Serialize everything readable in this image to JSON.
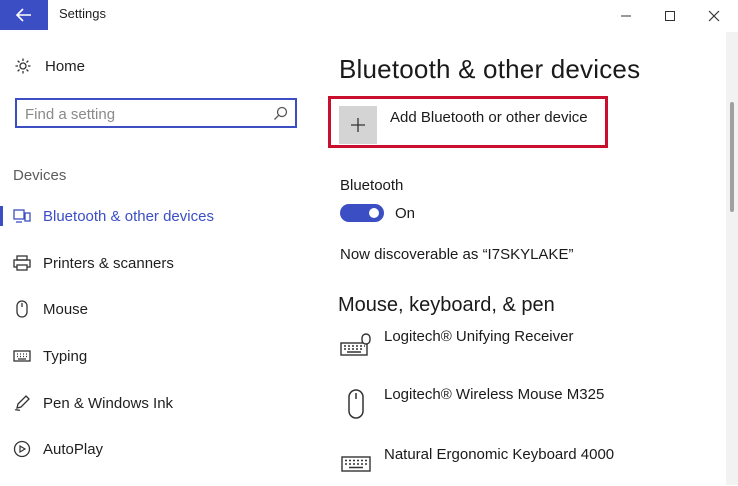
{
  "window": {
    "title": "Settings"
  },
  "sidebar": {
    "home_label": "Home",
    "search_placeholder": "Find a setting",
    "section_label": "Devices",
    "items": [
      {
        "label": "Bluetooth & other devices",
        "icon": "bluetooth-devices-icon",
        "active": true
      },
      {
        "label": "Printers & scanners",
        "icon": "printer-icon",
        "active": false
      },
      {
        "label": "Mouse",
        "icon": "mouse-icon",
        "active": false
      },
      {
        "label": "Typing",
        "icon": "keyboard-icon",
        "active": false
      },
      {
        "label": "Pen & Windows Ink",
        "icon": "pen-icon",
        "active": false
      },
      {
        "label": "AutoPlay",
        "icon": "autoplay-icon",
        "active": false
      }
    ]
  },
  "main": {
    "title": "Bluetooth & other devices",
    "add_device_label": "Add Bluetooth or other device",
    "bluetooth": {
      "label": "Bluetooth",
      "state": "On",
      "discoverable_text": "Now discoverable as “I7SKYLAKE”"
    },
    "section_title": "Mouse, keyboard, & pen",
    "devices": [
      {
        "name": "Logitech® Unifying Receiver",
        "icon": "keyboard-icon"
      },
      {
        "name": "Logitech® Wireless Mouse M325",
        "icon": "mouse-icon"
      },
      {
        "name": "Natural Ergonomic Keyboard 4000",
        "icon": "keyboard-icon"
      }
    ]
  },
  "colors": {
    "accent": "#3b4ec4",
    "highlight_frame": "#c8102e",
    "add_tile": "#d4d4d4"
  }
}
